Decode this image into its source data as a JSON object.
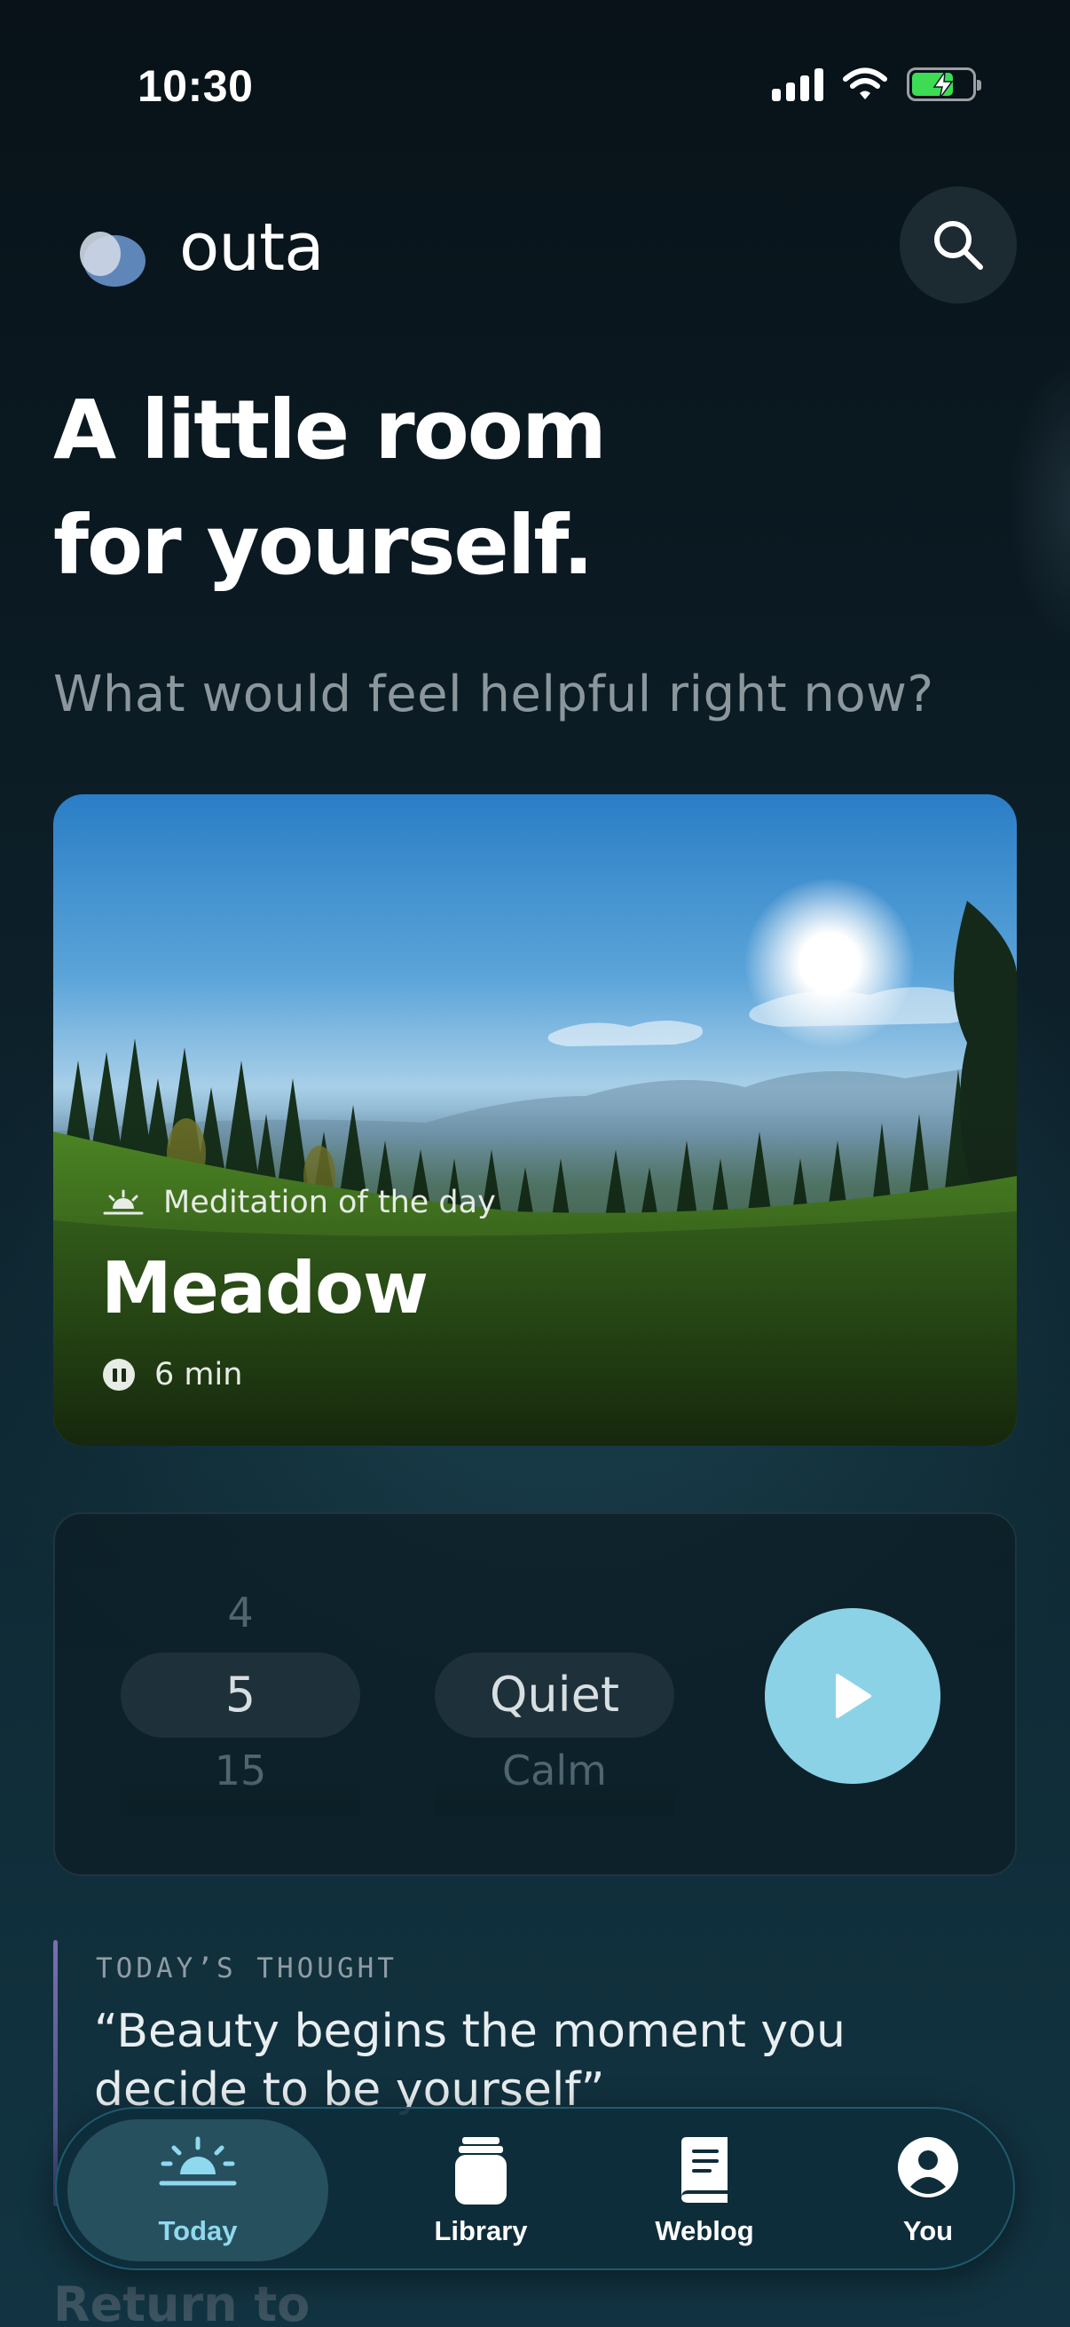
{
  "status_bar": {
    "time": "10:30"
  },
  "header": {
    "brand": "outa"
  },
  "hero": {
    "title_line1": "A little room",
    "title_line2": "for yourself.",
    "subtitle": "What would feel helpful right now?"
  },
  "meditation": {
    "label": "Meditation of the day",
    "title": "Meadow",
    "duration": "6 min"
  },
  "picker": {
    "duration_prev": "4",
    "duration_selected": "5",
    "duration_next": "15",
    "mood_selected": "Quiet",
    "mood_next": "Calm"
  },
  "thought": {
    "label": "TODAY’S THOUGHT",
    "quote": "“Beauty begins the moment you decide to be yourself”"
  },
  "next_section": {
    "title": "Return to"
  },
  "tab_bar": {
    "tabs": [
      {
        "label": "Today",
        "icon": "sunrise-icon",
        "active": true
      },
      {
        "label": "Library",
        "icon": "jar-icon",
        "active": false
      },
      {
        "label": "Weblog",
        "icon": "book-icon",
        "active": false
      },
      {
        "label": "You",
        "icon": "person-icon",
        "active": false
      }
    ]
  },
  "colors": {
    "background": "#0b1a22",
    "accent": "#8cd2e6",
    "active_tab_label": "#8fd9ee",
    "muted_text": "#8c979d",
    "battery": "#3ddc55"
  }
}
